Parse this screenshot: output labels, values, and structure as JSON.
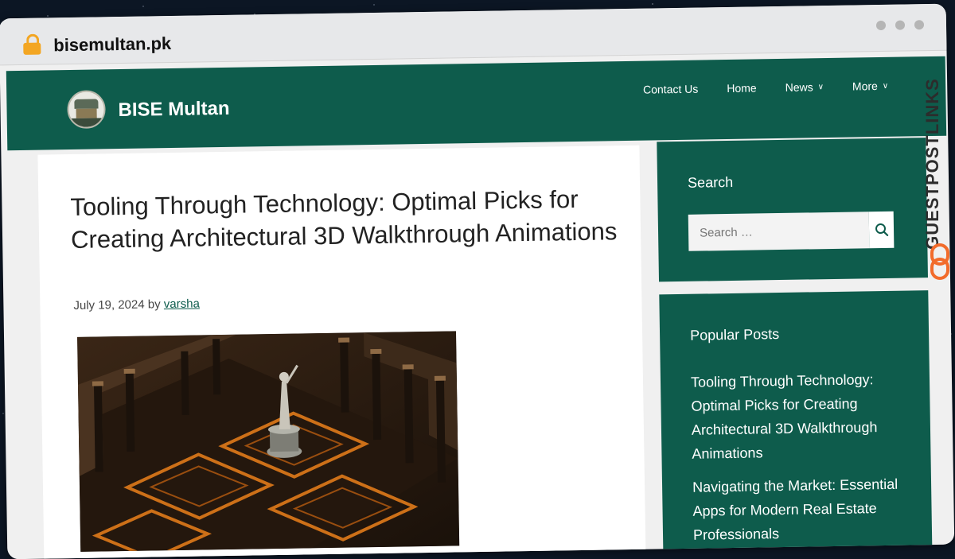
{
  "browser": {
    "url": "bisemultan.pk"
  },
  "header": {
    "site_title": "BISE Multan",
    "nav": [
      {
        "label": "Contact Us"
      },
      {
        "label": "Home"
      },
      {
        "label": "News"
      },
      {
        "label": "More"
      }
    ]
  },
  "article": {
    "title": "Tooling Through Technology: Optimal Picks for Creating Architectural 3D Walkthrough Animations",
    "date": "July 19, 2024",
    "by": "by",
    "author": "varsha"
  },
  "sidebar": {
    "search": {
      "title": "Search",
      "placeholder": "Search …"
    },
    "popular": {
      "title": "Popular Posts",
      "items": [
        "Tooling Through Technology: Optimal Picks for Creating Architectural 3D Walkthrough Animations",
        "Navigating the Market: Essential Apps for Modern Real Estate Professionals"
      ]
    }
  },
  "watermark": {
    "text": "GUESTPOSTLINKS"
  },
  "colors": {
    "brand_green": "#0e5c4c",
    "watermark_orange": "#f26b2b"
  }
}
